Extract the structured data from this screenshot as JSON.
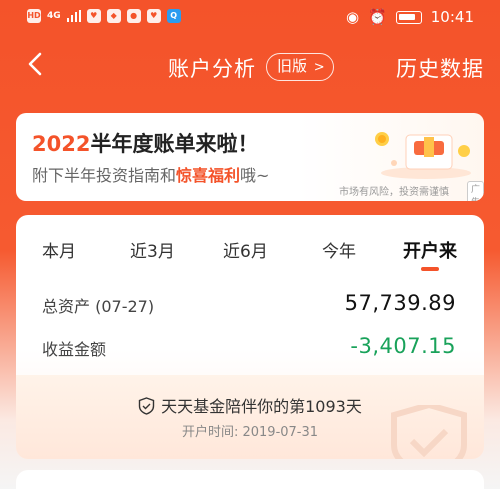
{
  "status_bar": {
    "left_icons": [
      "hd-icon",
      "signal-icon",
      "heart-app-icon",
      "app-icon",
      "app-icon",
      "heart-app-icon",
      "search-app-icon"
    ],
    "signal": "4G",
    "time": "10:41"
  },
  "nav": {
    "back_icon": "chevron-left-icon",
    "title": "账户分析",
    "old_version": "旧版",
    "history": "历史数据"
  },
  "banner": {
    "year": "2022",
    "headline_rest": "半年度账单来啦！",
    "sub_prefix": "附下半年投资指南和",
    "sub_highlight": "惊喜福利",
    "sub_suffix": "哦~",
    "risk_note": "市场有风险，投资需谨慎",
    "ad_tag": "广告"
  },
  "tabs": [
    {
      "label": "本月",
      "active": false
    },
    {
      "label": "近3月",
      "active": false
    },
    {
      "label": "近6月",
      "active": false
    },
    {
      "label": "今年",
      "active": false
    },
    {
      "label": "开户来",
      "active": true
    }
  ],
  "summary": {
    "total_assets_label": "总资产 (07-27)",
    "total_assets_value": "57,739.89",
    "profit_label": "收益金额",
    "profit_value": "-3,407.15"
  },
  "companion": {
    "text": "天天基金陪伴你的第1093天",
    "open_date": "开户时间: 2019-07-31"
  },
  "colors": {
    "brand": "#f4532a",
    "loss": "#19a25a"
  }
}
